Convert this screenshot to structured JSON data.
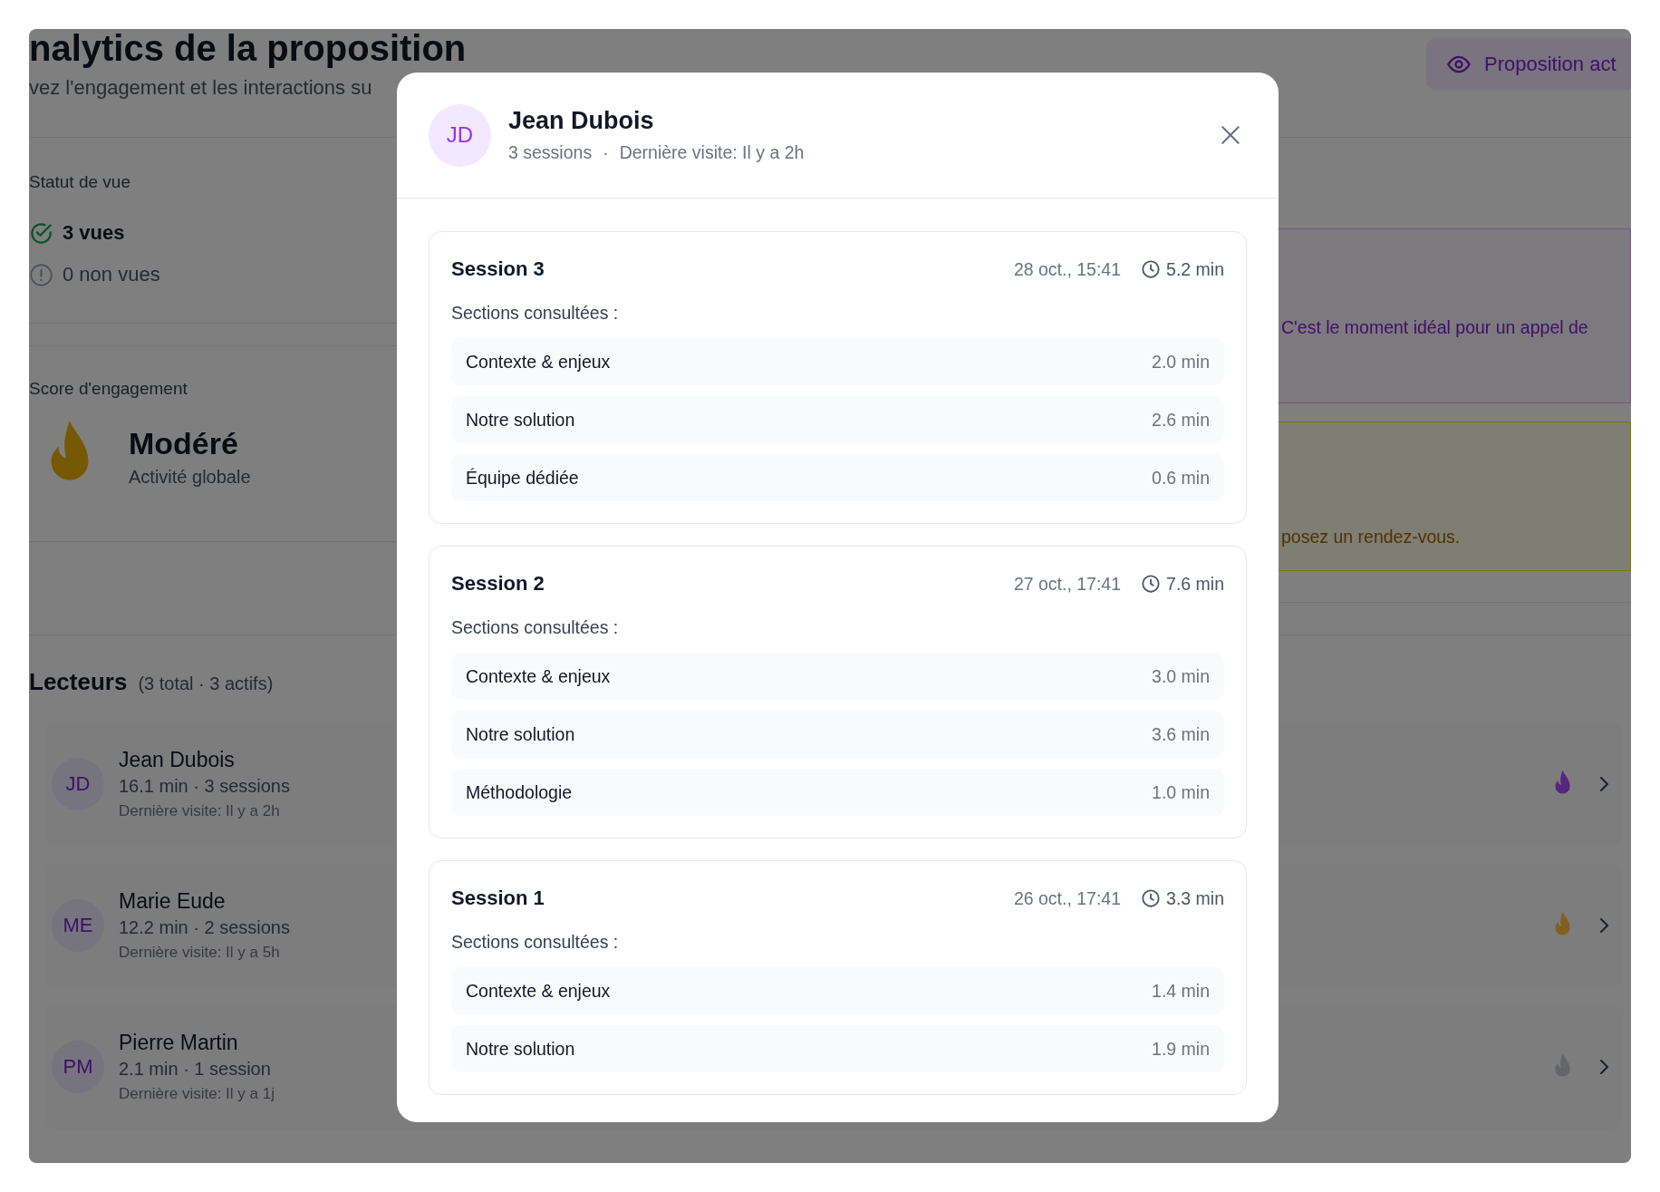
{
  "page": {
    "title": "nalytics de la proposition",
    "subtitle": "vez l'engagement et les interactions su",
    "status_button": "Proposition act"
  },
  "view_status": {
    "label": "Statut de vue",
    "items": [
      {
        "kind": "viewed",
        "text": "3 vues"
      },
      {
        "kind": "unviewed",
        "text": "0 non vues"
      }
    ]
  },
  "engagement": {
    "label": "Score d'engagement",
    "level_text": "Modéré",
    "caption": "Activité globale"
  },
  "alerts": [
    {
      "kind": "info",
      "text": "C'est le moment idéal pour un appel de"
    },
    {
      "kind": "warning",
      "text": "posez un rendez-vous."
    }
  ],
  "readers": {
    "title": "Lecteurs",
    "summary": "(3 total · 3 actifs)",
    "items": [
      {
        "initials": "JD",
        "name": "Jean Dubois",
        "stats": "16.1 min · 3 sessions",
        "last_visit": "Dernière visite: Il y a 2h",
        "color": "#58257f"
      },
      {
        "initials": "ME",
        "name": "Marie Eude",
        "stats": "12.2 min · 2 sessions",
        "last_visit": "Dernière visite: Il y a 5h",
        "color": "#806020"
      },
      {
        "initials": "PM",
        "name": "Pierre Martin",
        "stats": "2.1 min · 1 session",
        "last_visit": "Dernière visite: Il y a 1j",
        "color": "#646569"
      }
    ]
  },
  "modal": {
    "initials": "JD",
    "name": "Jean Dubois",
    "sessions": "3 sessions",
    "separator": "·",
    "last_visit": "Dernière visite: Il y a 2h",
    "session_list": [
      {
        "title": "Session 3",
        "date": "28 oct., 15:41",
        "duration": "5.2 min",
        "sections_label": "Sections consultées :",
        "sections": [
          {
            "name": "Contexte & enjeux",
            "time": "2.0 min"
          },
          {
            "name": "Notre solution",
            "time": "2.6 min"
          },
          {
            "name": "Équipe dédiée",
            "time": "0.6 min"
          }
        ]
      },
      {
        "title": "Session 2",
        "date": "27 oct., 17:41",
        "duration": "7.6 min",
        "sections_label": "Sections consultées :",
        "sections": [
          {
            "name": "Contexte & enjeux",
            "time": "3.0 min"
          },
          {
            "name": "Notre solution",
            "time": "3.6 min"
          },
          {
            "name": "Méthodologie",
            "time": "1.0 min"
          }
        ]
      },
      {
        "title": "Session 1",
        "date": "26 oct., 17:41",
        "duration": "3.3 min",
        "sections_label": "Sections consultées :",
        "sections": [
          {
            "name": "Contexte & enjeux",
            "time": "1.4 min"
          },
          {
            "name": "Notre solution",
            "time": "1.9 min"
          }
        ]
      }
    ]
  }
}
